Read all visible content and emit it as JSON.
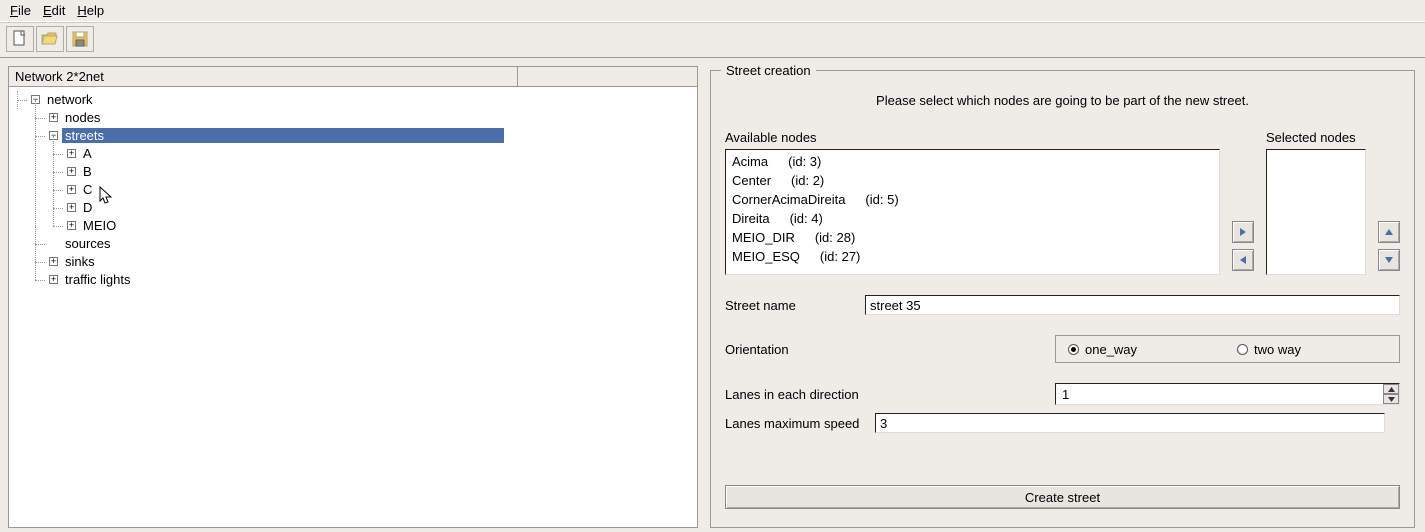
{
  "menu": {
    "file": "File",
    "edit": "Edit",
    "help": "Help"
  },
  "toolbar": {
    "new": "new-icon",
    "open": "open-icon",
    "save": "save-icon"
  },
  "left_panel": {
    "title": "Network 2*2net",
    "tree": {
      "root": "network",
      "nodes_label": "nodes",
      "streets_label": "streets",
      "streets_children": [
        "A",
        "B",
        "C",
        "D",
        "MEIO"
      ],
      "sources_label": "sources",
      "sinks_label": "sinks",
      "traffic_lights_label": "traffic lights"
    }
  },
  "right_panel": {
    "group_title": "Street creation",
    "instruction": "Please select which nodes are going to be part of the new street.",
    "available_label": "Available nodes",
    "selected_label": "Selected nodes",
    "available_nodes": [
      {
        "name": "Acima",
        "id_text": "(id: 3)"
      },
      {
        "name": "Center",
        "id_text": "(id: 2)"
      },
      {
        "name": "CornerAcimaDireita",
        "id_text": "(id: 5)"
      },
      {
        "name": "Direita",
        "id_text": "(id: 4)"
      },
      {
        "name": "MEIO_DIR",
        "id_text": "(id: 28)"
      },
      {
        "name": "MEIO_ESQ",
        "id_text": "(id: 27)"
      }
    ],
    "street_name_label": "Street name",
    "street_name_value": "street 35",
    "orientation_label": "Orientation",
    "orientation_one_way": "one_way",
    "orientation_two_way": "two way",
    "orientation_selected": "one_way",
    "lanes_label": "Lanes in each direction",
    "lanes_value": "1",
    "maxspeed_label": "Lanes maximum speed",
    "maxspeed_value": "3",
    "create_button": "Create street"
  }
}
